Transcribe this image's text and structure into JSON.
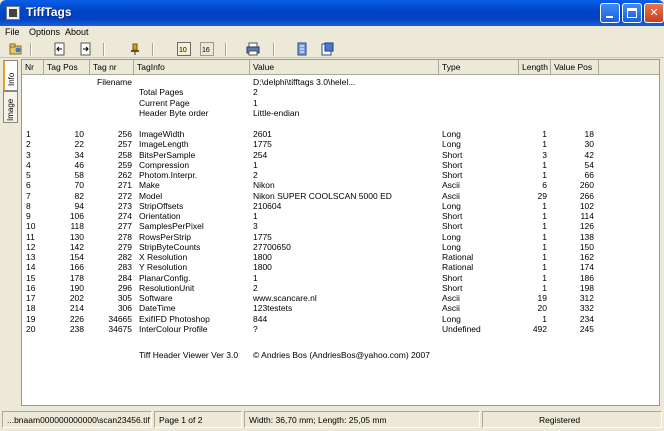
{
  "window": {
    "title": "TiffTags"
  },
  "menu": [
    "File",
    "Options",
    "About"
  ],
  "toolbar": {
    "icons": [
      "open-folder-icon",
      "back-icon",
      "forward-icon",
      "pin-icon",
      "toggle-a-icon",
      "toggle-b-icon",
      "print-icon",
      "document-icon",
      "export-icon"
    ]
  },
  "tabs": {
    "info": "Info",
    "image": "Image"
  },
  "grid": {
    "headers": [
      "Nr",
      "Tag Pos",
      "Tag nr",
      "TagInfo",
      "Value",
      "Type",
      "Length",
      "Value Pos"
    ],
    "meta": [
      {
        "taginfo": "Filename",
        "value": "D:\\delphi\\tifftags 3.0\\helel..."
      },
      {
        "taginfo": "Total Pages",
        "value": "2"
      },
      {
        "taginfo": "Current Page",
        "value": "1"
      },
      {
        "taginfo": "Header Byte order",
        "value": "Little-endian"
      }
    ],
    "rows": [
      [
        "1",
        "10",
        "256",
        "ImageWidth",
        "2601",
        "Long",
        "1",
        "18"
      ],
      [
        "2",
        "22",
        "257",
        "ImageLength",
        "1775",
        "Long",
        "1",
        "30"
      ],
      [
        "3",
        "34",
        "258",
        "BitsPerSample",
        "254",
        "Short",
        "3",
        "42"
      ],
      [
        "4",
        "46",
        "259",
        "Compression",
        "1",
        "Short",
        "1",
        "54"
      ],
      [
        "5",
        "58",
        "262",
        "Photom.Interpr.",
        "2",
        "Short",
        "1",
        "66"
      ],
      [
        "6",
        "70",
        "271",
        "Make",
        "Nikon",
        "Ascii",
        "6",
        "260"
      ],
      [
        "7",
        "82",
        "272",
        "Model",
        "Nikon SUPER COOLSCAN 5000 ED",
        "Ascii",
        "29",
        "266"
      ],
      [
        "8",
        "94",
        "273",
        "StripOffsets",
        "210604",
        "Long",
        "1",
        "102"
      ],
      [
        "9",
        "106",
        "274",
        "Orientation",
        "1",
        "Short",
        "1",
        "114"
      ],
      [
        "10",
        "118",
        "277",
        "SamplesPerPixel",
        "3",
        "Short",
        "1",
        "126"
      ],
      [
        "11",
        "130",
        "278",
        "RowsPerStrip",
        "1775",
        "Long",
        "1",
        "138"
      ],
      [
        "12",
        "142",
        "279",
        "StripByteCounts",
        "27700650",
        "Long",
        "1",
        "150"
      ],
      [
        "13",
        "154",
        "282",
        "X Resolution",
        "1800",
        "Rational",
        "1",
        "162"
      ],
      [
        "14",
        "166",
        "283",
        "Y Resolution",
        "1800",
        "Rational",
        "1",
        "174"
      ],
      [
        "15",
        "178",
        "284",
        "PlanarConfig.",
        "1",
        "Short",
        "1",
        "186"
      ],
      [
        "16",
        "190",
        "296",
        "ResolutionUnit",
        "2",
        "Short",
        "1",
        "198"
      ],
      [
        "17",
        "202",
        "305",
        "Software",
        "www.scancare.nl",
        "Ascii",
        "19",
        "312"
      ],
      [
        "18",
        "214",
        "306",
        "DateTime",
        "123testets",
        "Ascii",
        "20",
        "332"
      ],
      [
        "19",
        "226",
        "34665",
        "ExifIFD Photoshop",
        "844",
        "Long",
        "1",
        "234"
      ],
      [
        "20",
        "238",
        "34675",
        "InterColour Profile",
        "?",
        "Undefined",
        "492",
        "245"
      ]
    ],
    "footer": {
      "taginfo": "Tiff Header Viewer Ver 3.0",
      "value": "© Andries Bos (AndriesBos@yahoo.com) 2007"
    }
  },
  "status": {
    "file": "...bnaam000000000000\\scan23456.tif",
    "page": "Page 1 of 2",
    "width_label": "Width:",
    "width_value": "36,70 mm;",
    "length_label": "Length:",
    "length_value": "25,05 mm",
    "registered": "Registered"
  },
  "colors": {
    "titlebar": "#0046c8",
    "window_bg": "#ece9d8",
    "grid_bg": "#ffffff"
  }
}
